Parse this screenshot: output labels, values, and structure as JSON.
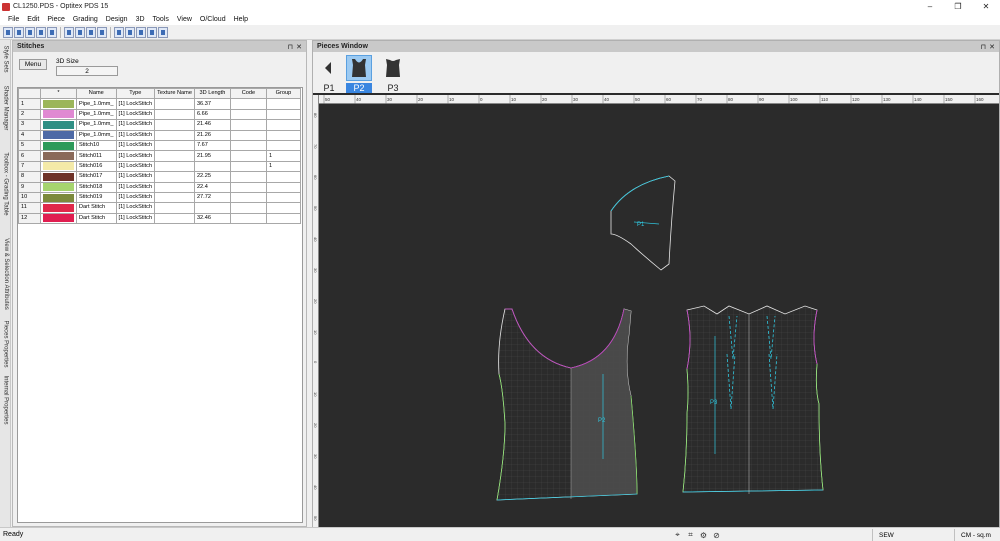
{
  "window": {
    "title": "CL1250.PDS - Optitex PDS 15",
    "minimize": "–",
    "restore": "❐",
    "close": "✕"
  },
  "menu": [
    "File",
    "Edit",
    "Piece",
    "Grading",
    "Design",
    "3D",
    "Tools",
    "View",
    "O/Cloud",
    "Help"
  ],
  "side_tabs": [
    "Style Sets",
    "Shader Manager",
    "Toolbox - Grading Table",
    "View & Selection Attributes",
    "Pieces Properties",
    "Internal Properties"
  ],
  "stitches": {
    "title": "Stitches",
    "pin": "⊓",
    "close": "✕",
    "menu_label": "Menu",
    "size_label": "3D Size",
    "size_value": "2",
    "columns": [
      "",
      "*",
      "Name",
      "Type",
      "Texture Name",
      "3D Length",
      "Code",
      "Group"
    ],
    "rows": [
      {
        "n": "1",
        "color": "#9bb65a",
        "name": "Pipe_1.0mm_",
        "type": "[1] LockStitch",
        "tex": "",
        "len": "36.37",
        "code": "",
        "group": ""
      },
      {
        "n": "2",
        "color": "#e089d2",
        "name": "Pipe_1.0mm_",
        "type": "[1] LockStitch",
        "tex": "",
        "len": "6.66",
        "code": "",
        "group": ""
      },
      {
        "n": "3",
        "color": "#2f8f84",
        "name": "Pipe_1.0mm_",
        "type": "[1] LockStitch",
        "tex": "",
        "len": "21.46",
        "code": "",
        "group": ""
      },
      {
        "n": "4",
        "color": "#4e6aa6",
        "name": "Pipe_1.0mm_",
        "type": "[1] LockStitch",
        "tex": "",
        "len": "21.26",
        "code": "",
        "group": ""
      },
      {
        "n": "5",
        "color": "#2d9a5a",
        "name": "Stitch10",
        "type": "[1] LockStitch",
        "tex": "",
        "len": "7.67",
        "code": "",
        "group": ""
      },
      {
        "n": "6",
        "color": "#8a6a5a",
        "name": "Stitch011",
        "type": "[1] LockStitch",
        "tex": "",
        "len": "21.95",
        "code": "",
        "group": "1"
      },
      {
        "n": "7",
        "color": "#f4eaa8",
        "name": "Stitch016",
        "type": "[1] LockStitch",
        "tex": "",
        "len": "",
        "code": "",
        "group": "1"
      },
      {
        "n": "8",
        "color": "#6e3228",
        "name": "Stitch017",
        "type": "[1] LockStitch",
        "tex": "",
        "len": "22.25",
        "code": "",
        "group": ""
      },
      {
        "n": "9",
        "color": "#a6d46e",
        "name": "Stitch018",
        "type": "[1] LockStitch",
        "tex": "",
        "len": "22.4",
        "code": "",
        "group": ""
      },
      {
        "n": "10",
        "color": "#7c8a3c",
        "name": "Stitch019",
        "type": "[1] LockStitch",
        "tex": "",
        "len": "27.72",
        "code": "",
        "group": ""
      },
      {
        "n": "11",
        "color": "#e0284a",
        "name": "Dart Stitch",
        "type": "[1] LockStitch",
        "tex": "",
        "len": "",
        "code": "",
        "group": ""
      },
      {
        "n": "12",
        "color": "#e01e50",
        "name": "Dart Stitch",
        "type": "[1] LockStitch",
        "tex": "",
        "len": "32.46",
        "code": "",
        "group": ""
      }
    ]
  },
  "pieces": {
    "title": "Pieces Window",
    "pin": "⊓",
    "close": "✕",
    "thumbs": [
      {
        "label": "P1",
        "selected": false
      },
      {
        "label": "P2",
        "selected": true
      },
      {
        "label": "P3",
        "selected": false
      }
    ],
    "top_ruler_labels": [
      "50",
      "40",
      "30",
      "20",
      "10",
      "0",
      "10",
      "20",
      "30",
      "40",
      "50",
      "60",
      "70",
      "80",
      "90",
      "100",
      "110",
      "120",
      "130",
      "140",
      "150",
      "160"
    ],
    "left_ruler_labels": [
      "80",
      "70",
      "60",
      "50",
      "40",
      "30",
      "20",
      "10",
      "0",
      "10",
      "20",
      "30",
      "40",
      "50"
    ],
    "piece_labels": [
      "P1",
      "P2",
      "P3"
    ]
  },
  "status": {
    "ready": "Ready",
    "mode": "SEW",
    "units": "CM - sq.m"
  }
}
